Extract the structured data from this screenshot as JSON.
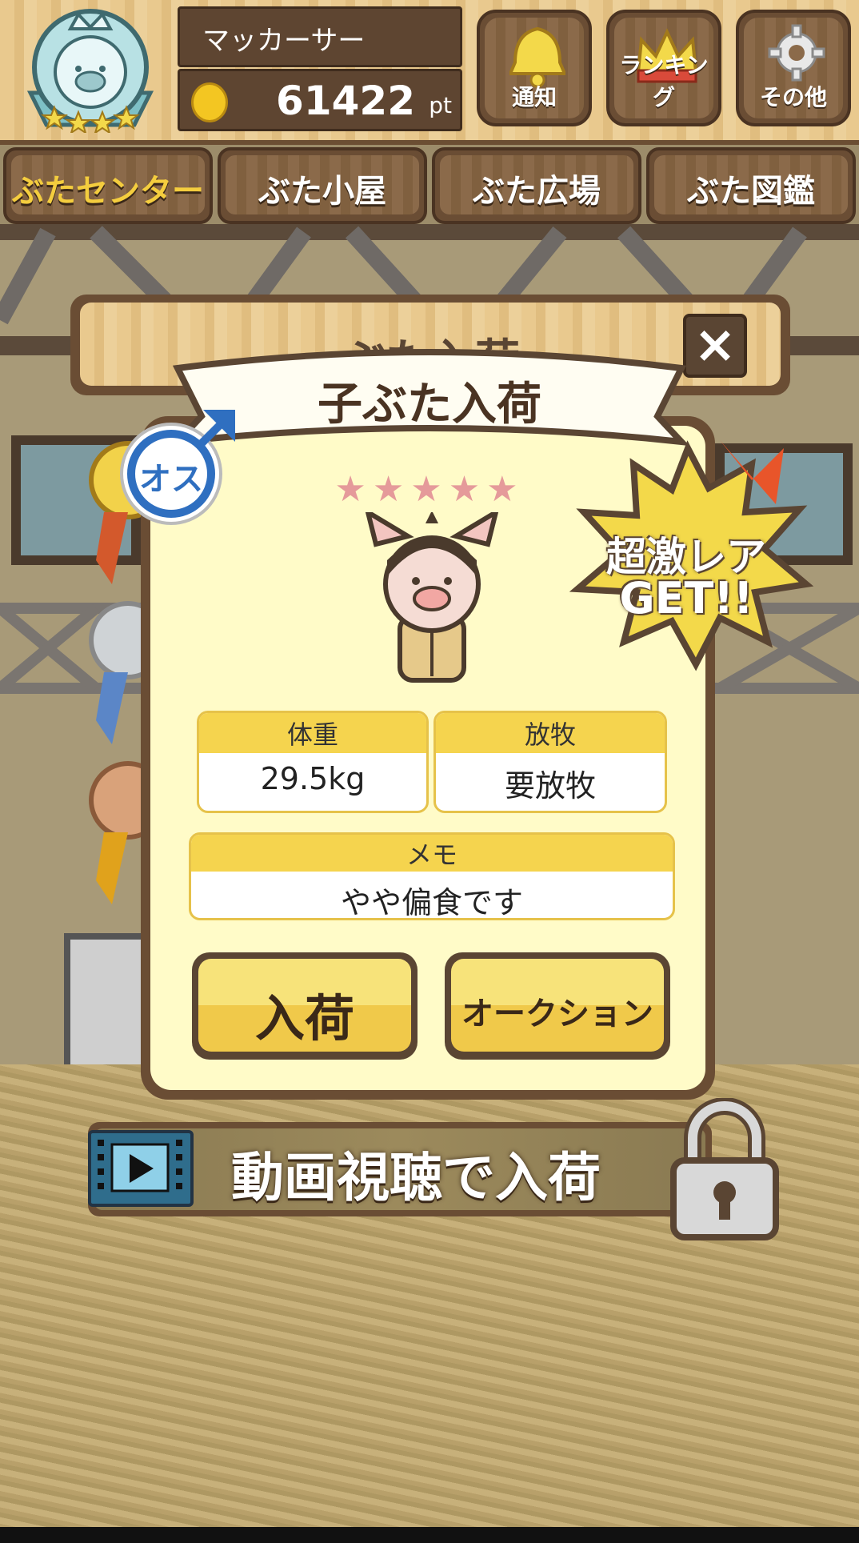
{
  "header": {
    "player_name": "マッカーサー",
    "points": "61422",
    "points_unit": "pt",
    "buttons": [
      {
        "label": "通知",
        "icon": "bell-icon"
      },
      {
        "label": "ランキング",
        "icon": "crown-icon"
      },
      {
        "label": "その他",
        "icon": "gear-icon"
      }
    ]
  },
  "tabs": [
    {
      "label": "ぶたセンター",
      "active": true
    },
    {
      "label": "ぶた小屋",
      "active": false
    },
    {
      "label": "ぶた広場",
      "active": false
    },
    {
      "label": "ぶた図鑑",
      "active": false
    }
  ],
  "background_panel": {
    "title": "ぶた入荷"
  },
  "dialog": {
    "title": "子ぶた入荷",
    "gender_badge": "オス",
    "rarity_stars": "★★★★★",
    "rare_burst": {
      "line1": "超激レア",
      "line2": "GET!!"
    },
    "weight": {
      "label": "体重",
      "value": "29.5kg"
    },
    "grazing": {
      "label": "放牧",
      "value": "要放牧"
    },
    "memo": {
      "label": "メモ",
      "value": "やや偏食です"
    },
    "buttons": {
      "receive": "入荷",
      "auction": "オークション"
    }
  },
  "video_bar": {
    "label": "動画視聴で入荷"
  },
  "colors": {
    "wood": "#e9c98e",
    "dark_wood": "#6a4d34",
    "dialog_bg": "#fffbc8",
    "yellow": "#f5d44e",
    "burst": "#f3d94a"
  }
}
